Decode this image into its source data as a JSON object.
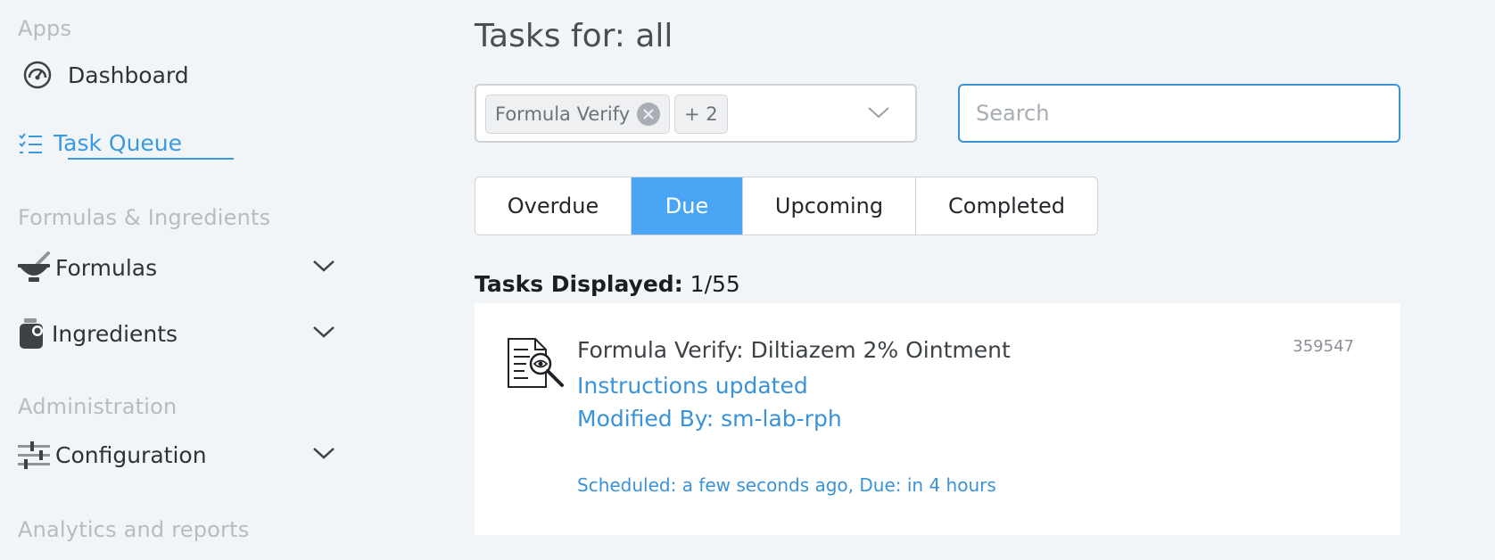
{
  "sidebar": {
    "sections": {
      "apps": "Apps",
      "formulas_ingredients": "Formulas & Ingredients",
      "administration": "Administration",
      "analytics": "Analytics and reports"
    },
    "items": {
      "dashboard": "Dashboard",
      "task_queue": "Task Queue",
      "formulas": "Formulas",
      "ingredients": "Ingredients",
      "configuration": "Configuration"
    }
  },
  "main": {
    "title": "Tasks for: all",
    "filter": {
      "chip_label": "Formula Verify",
      "more_label": "+ 2"
    },
    "search": {
      "placeholder": "Search"
    },
    "tabs": [
      "Overdue",
      "Due",
      "Upcoming",
      "Completed"
    ],
    "selected_tab": "Due",
    "displayed": {
      "label": "Tasks Displayed:",
      "value": "1/55"
    },
    "task": {
      "title": "Formula Verify: Diltiazem 2% Ointment",
      "subtitle": "Instructions updated",
      "modified_by": "Modified By: sm-lab-rph",
      "scheduled": "Scheduled: a few seconds ago, Due: in 4 hours",
      "id": "359547",
      "icon": "document-inspect-icon"
    }
  },
  "colors": {
    "accent": "#3a93d6",
    "selected_tab": "#4aa6f5",
    "background": "#f2f5f8"
  }
}
